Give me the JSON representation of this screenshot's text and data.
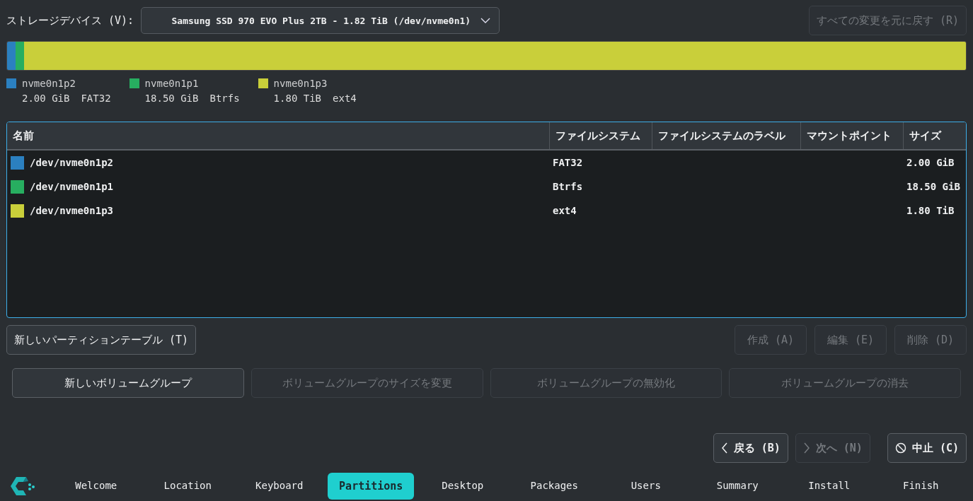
{
  "device": {
    "label": "ストレージデバイス (V):",
    "value": "Samsung SSD 970 EVO Plus 2TB - 1.82 TiB (/dev/nvme0n1)"
  },
  "revert_button": {
    "label": "すべての変更を元に戻す (R)",
    "disabled": true
  },
  "partitions": [
    {
      "name": "nvme0n1p2",
      "size": "2.00 GiB",
      "fs": "FAT32",
      "color": "#2b80c0",
      "level": 0.009
    },
    {
      "name": "nvme0n1p1",
      "size": "18.50 GiB",
      "fs": "Btrfs",
      "color": "#27ae60",
      "level": 0.009
    },
    {
      "name": "nvme0n1p3",
      "size": "1.80 TiB",
      "fs": "ext4",
      "color": "#c9cf3a",
      "level": 0.982
    }
  ],
  "table": {
    "columns": [
      "名前",
      "ファイルシステム",
      "ファイルシステムのラベル",
      "マウントポイント",
      "サイズ"
    ],
    "rows": [
      {
        "name": "/dev/nvme0n1p2",
        "color": "#2b80c0",
        "fs": "FAT32",
        "size": "2.00 GiB"
      },
      {
        "name": "/dev/nvme0n1p1",
        "color": "#27ae60",
        "fs": "Btrfs",
        "size": "18.50 GiB"
      },
      {
        "name": "/dev/nvme0n1p3",
        "color": "#c9cf3a",
        "fs": "ext4",
        "size": "1.80 TiB"
      }
    ]
  },
  "new_table_button": {
    "label": "新しいパーティションテーブル (T)",
    "disabled": false
  },
  "partition_buttons": [
    {
      "label": "作成 (A)",
      "disabled": true
    },
    {
      "label": "編集 (E)",
      "disabled": true
    },
    {
      "label": "削除 (D)",
      "disabled": true
    }
  ],
  "volume_buttons": [
    {
      "label": "新しいボリュームグループ",
      "disabled": false
    },
    {
      "label": "ボリュームグループのサイズを変更",
      "disabled": true
    },
    {
      "label": "ボリュームグループの無効化",
      "disabled": true
    },
    {
      "label": "ボリュームグループの消去",
      "disabled": true
    }
  ],
  "nav_buttons": [
    {
      "kind": "back",
      "label": "戻る (B)",
      "disabled": false
    },
    {
      "kind": "next",
      "label": "次へ (N)",
      "disabled": true
    },
    {
      "kind": "cancel",
      "label": "中止 (C)",
      "disabled": false
    }
  ],
  "steps": [
    {
      "label": "Welcome",
      "selected": false
    },
    {
      "label": "Location",
      "selected": false
    },
    {
      "label": "Keyboard",
      "selected": false
    },
    {
      "label": "Partitions",
      "selected": true
    },
    {
      "label": "Desktop",
      "selected": false
    },
    {
      "label": "Packages",
      "selected": false
    },
    {
      "label": "Users",
      "selected": false
    },
    {
      "label": "Summary",
      "selected": false
    },
    {
      "label": "Install",
      "selected": false
    },
    {
      "label": "Finish",
      "selected": false
    }
  ]
}
